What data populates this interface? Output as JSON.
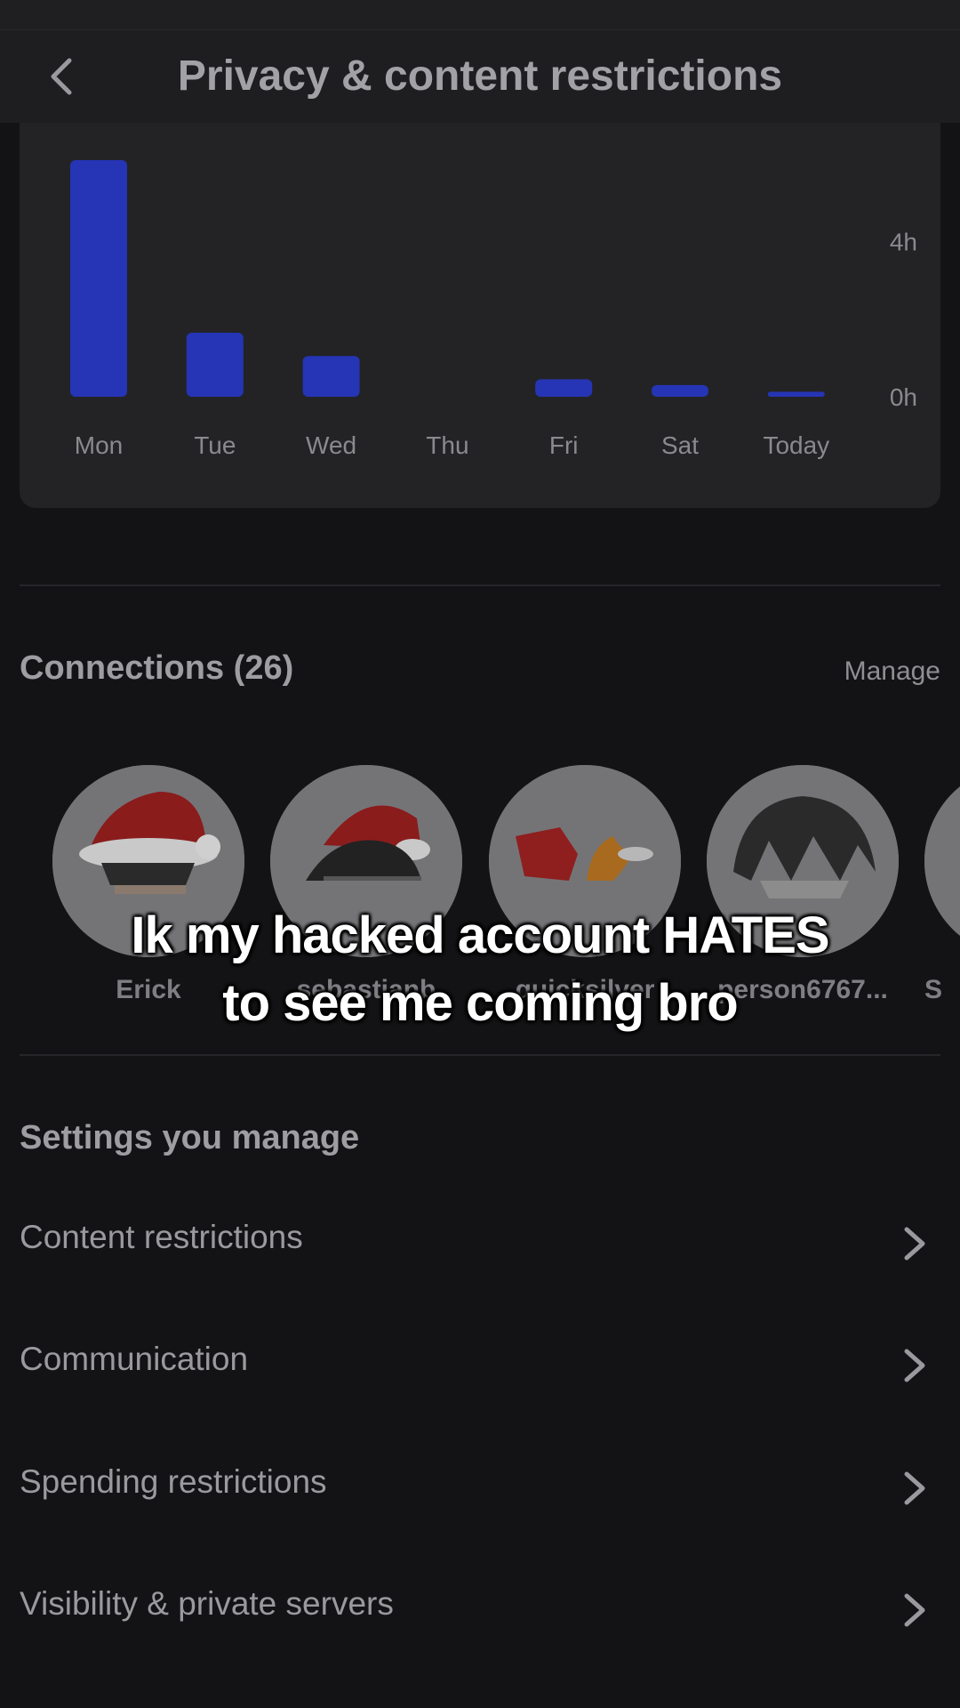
{
  "header": {
    "title": "Privacy & content restrictions",
    "back_icon": "chevron-left-icon"
  },
  "chart_data": {
    "type": "bar",
    "categories": [
      "Mon",
      "Tue",
      "Wed",
      "Thu",
      "Fri",
      "Sat",
      "Today"
    ],
    "values": [
      6.1,
      1.65,
      1.05,
      0,
      0.45,
      0.3,
      0.13
    ],
    "yticks": [
      "4h",
      "0h"
    ],
    "ytick_values": [
      4,
      0
    ],
    "ylim": [
      0,
      6.1
    ],
    "bar_color": "#2535b5"
  },
  "connections": {
    "title": "Connections (26)",
    "manage_label": "Manage",
    "items": [
      {
        "name": "Erick",
        "avatar": "avatar-santa-hat"
      },
      {
        "name": "sebastianb",
        "avatar": "avatar-santa-hat-dark-hair"
      },
      {
        "name": "quicksilver",
        "avatar": "avatar-red-fire"
      },
      {
        "name": "person6767...",
        "avatar": "avatar-grey-hair"
      },
      {
        "name": "S",
        "avatar": "avatar-partial"
      }
    ]
  },
  "caption": {
    "line1": "Ik my hacked account HATES",
    "line2": "to see me coming bro"
  },
  "settings": {
    "title": "Settings you manage",
    "items": [
      {
        "label": "Content restrictions",
        "icon": "chevron-right-icon"
      },
      {
        "label": "Communication",
        "icon": "chevron-right-icon"
      },
      {
        "label": "Spending restrictions",
        "icon": "chevron-right-icon"
      },
      {
        "label": "Visibility & private servers",
        "icon": "chevron-right-icon"
      }
    ]
  }
}
